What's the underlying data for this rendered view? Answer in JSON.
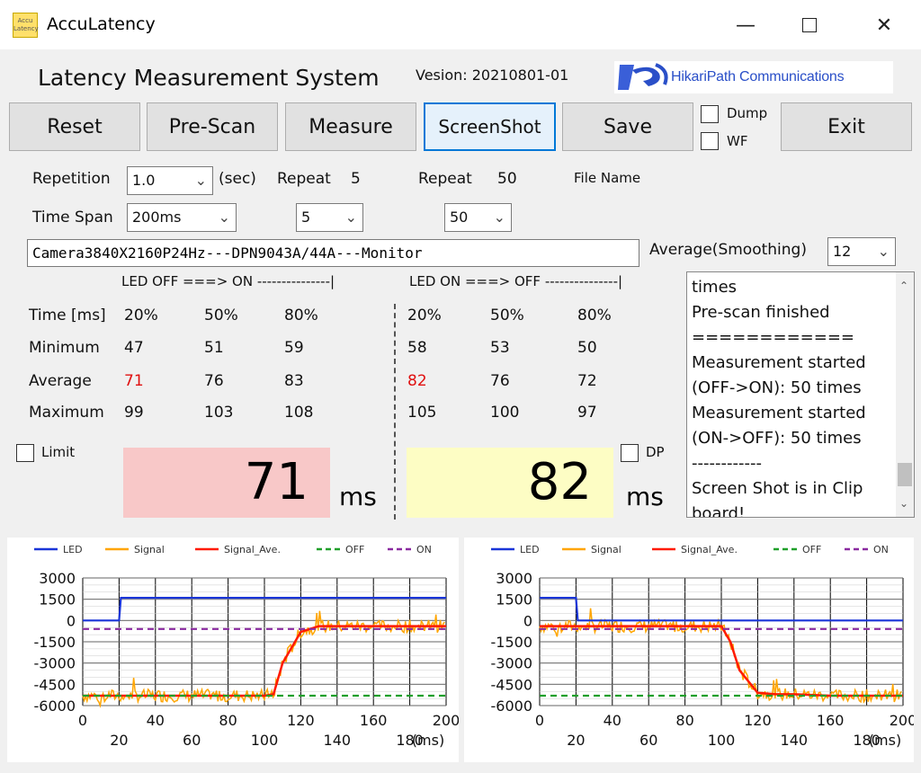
{
  "window": {
    "title": "AccuLatency",
    "icon_text_1": "Accu",
    "icon_text_2": "Latency"
  },
  "header": {
    "title": "Latency Measurement System",
    "version": "Vesion: 20210801-01",
    "logo_text": "HikariPath Communications"
  },
  "toolbar": {
    "reset": "Reset",
    "prescan": "Pre-Scan",
    "measure": "Measure",
    "screenshot": "ScreenShot",
    "save": "Save",
    "exit": "Exit",
    "dump": "Dump",
    "wf": "WF"
  },
  "settings": {
    "repetition_label": "Repetition",
    "repetition_value": "1.0",
    "sec": "(sec)",
    "timespan_label": "Time Span",
    "timespan_value": "200ms",
    "repeat5_label": "Repeat",
    "repeat5_value": "5",
    "repeat5_select": "5",
    "repeat50_label": "Repeat",
    "repeat50_value": "50",
    "repeat50_select": "50",
    "filename_label": "File Name",
    "filename_value": "Camera3840X2160P24Hz---DPN9043A/44A---Monitor",
    "avg_label": "Average(Smoothing)",
    "avg_value": "12"
  },
  "results": {
    "off_on_head": "LED OFF ===> ON ---------------|",
    "on_off_head": "LED ON ===> OFF ---------------|",
    "row_labels": [
      "Time [ms]",
      "Minimum",
      "Average",
      "Maximum"
    ],
    "off_on": [
      [
        "20%",
        "50%",
        "80%"
      ],
      [
        "47",
        "51",
        "59"
      ],
      [
        "71",
        "76",
        "83"
      ],
      [
        "99",
        "103",
        "108"
      ]
    ],
    "on_off": [
      [
        "20%",
        "50%",
        "80%"
      ],
      [
        "58",
        "53",
        "50"
      ],
      [
        "82",
        "76",
        "72"
      ],
      [
        "105",
        "100",
        "97"
      ]
    ],
    "limit": "Limit",
    "dp": "DP",
    "big_off_on": "71",
    "big_on_off": "82",
    "unit": "ms"
  },
  "log": {
    "lines": [
      "times",
      "Pre-scan finished",
      "============",
      "Measurement started",
      "(OFF->ON): 50 times",
      "Measurement started",
      "(ON->OFF): 50 times",
      "------------",
      "Screen Shot is in Clip",
      "board!"
    ]
  },
  "charts": {
    "legend": [
      "LED",
      "Signal",
      "Signal_Ave.",
      "OFF",
      "ON"
    ],
    "colors": {
      "led": "#1a35d8",
      "signal": "#ffa500",
      "signal_ave": "#ff1a00",
      "off": "#1f9f2a",
      "on": "#8a2aa0"
    },
    "yticks": [
      "3000",
      "1500",
      "0",
      "-1500",
      "-3000",
      "-4500",
      "-6000"
    ],
    "xticks_top": [
      "0",
      "40",
      "80",
      "120",
      "160",
      "200"
    ],
    "xticks_bottom": [
      "20",
      "60",
      "100",
      "140",
      "180"
    ],
    "xunit": "(ms)"
  },
  "chart_data": [
    {
      "type": "line",
      "x": [
        0,
        20,
        21,
        100,
        105,
        110,
        120,
        130,
        140,
        160,
        180,
        200
      ],
      "ylim": [
        -6000,
        3000
      ],
      "xlim": [
        0,
        200
      ],
      "series": [
        {
          "name": "LED",
          "values": [
            0,
            0,
            1600,
            1600,
            1600,
            1600,
            1600,
            1600,
            1600,
            1600,
            1600,
            1600
          ]
        },
        {
          "name": "Signal_Ave.",
          "values": [
            -5300,
            -5300,
            -5300,
            -5300,
            -5200,
            -3000,
            -800,
            -400,
            -400,
            -400,
            -400,
            -400
          ]
        },
        {
          "name": "OFF",
          "values": [
            -5300,
            -5300,
            -5300,
            -5300,
            -5300,
            -5300,
            -5300,
            -5300,
            -5300,
            -5300,
            -5300,
            -5300
          ]
        },
        {
          "name": "ON",
          "values": [
            -600,
            -600,
            -600,
            -600,
            -600,
            -600,
            -600,
            -600,
            -600,
            -600,
            -600,
            -600
          ]
        }
      ]
    },
    {
      "type": "line",
      "x": [
        0,
        20,
        21,
        100,
        105,
        110,
        120,
        130,
        140,
        160,
        180,
        200
      ],
      "ylim": [
        -6000,
        3000
      ],
      "xlim": [
        0,
        200
      ],
      "series": [
        {
          "name": "LED",
          "values": [
            1600,
            1600,
            0,
            0,
            0,
            0,
            0,
            0,
            0,
            0,
            0,
            0
          ]
        },
        {
          "name": "Signal_Ave.",
          "values": [
            -400,
            -400,
            -400,
            -400,
            -1500,
            -3500,
            -5100,
            -5200,
            -5200,
            -5300,
            -5300,
            -5300
          ]
        },
        {
          "name": "OFF",
          "values": [
            -5300,
            -5300,
            -5300,
            -5300,
            -5300,
            -5300,
            -5300,
            -5300,
            -5300,
            -5300,
            -5300,
            -5300
          ]
        },
        {
          "name": "ON",
          "values": [
            -600,
            -600,
            -600,
            -600,
            -600,
            -600,
            -600,
            -600,
            -600,
            -600,
            -600,
            -600
          ]
        }
      ]
    }
  ]
}
